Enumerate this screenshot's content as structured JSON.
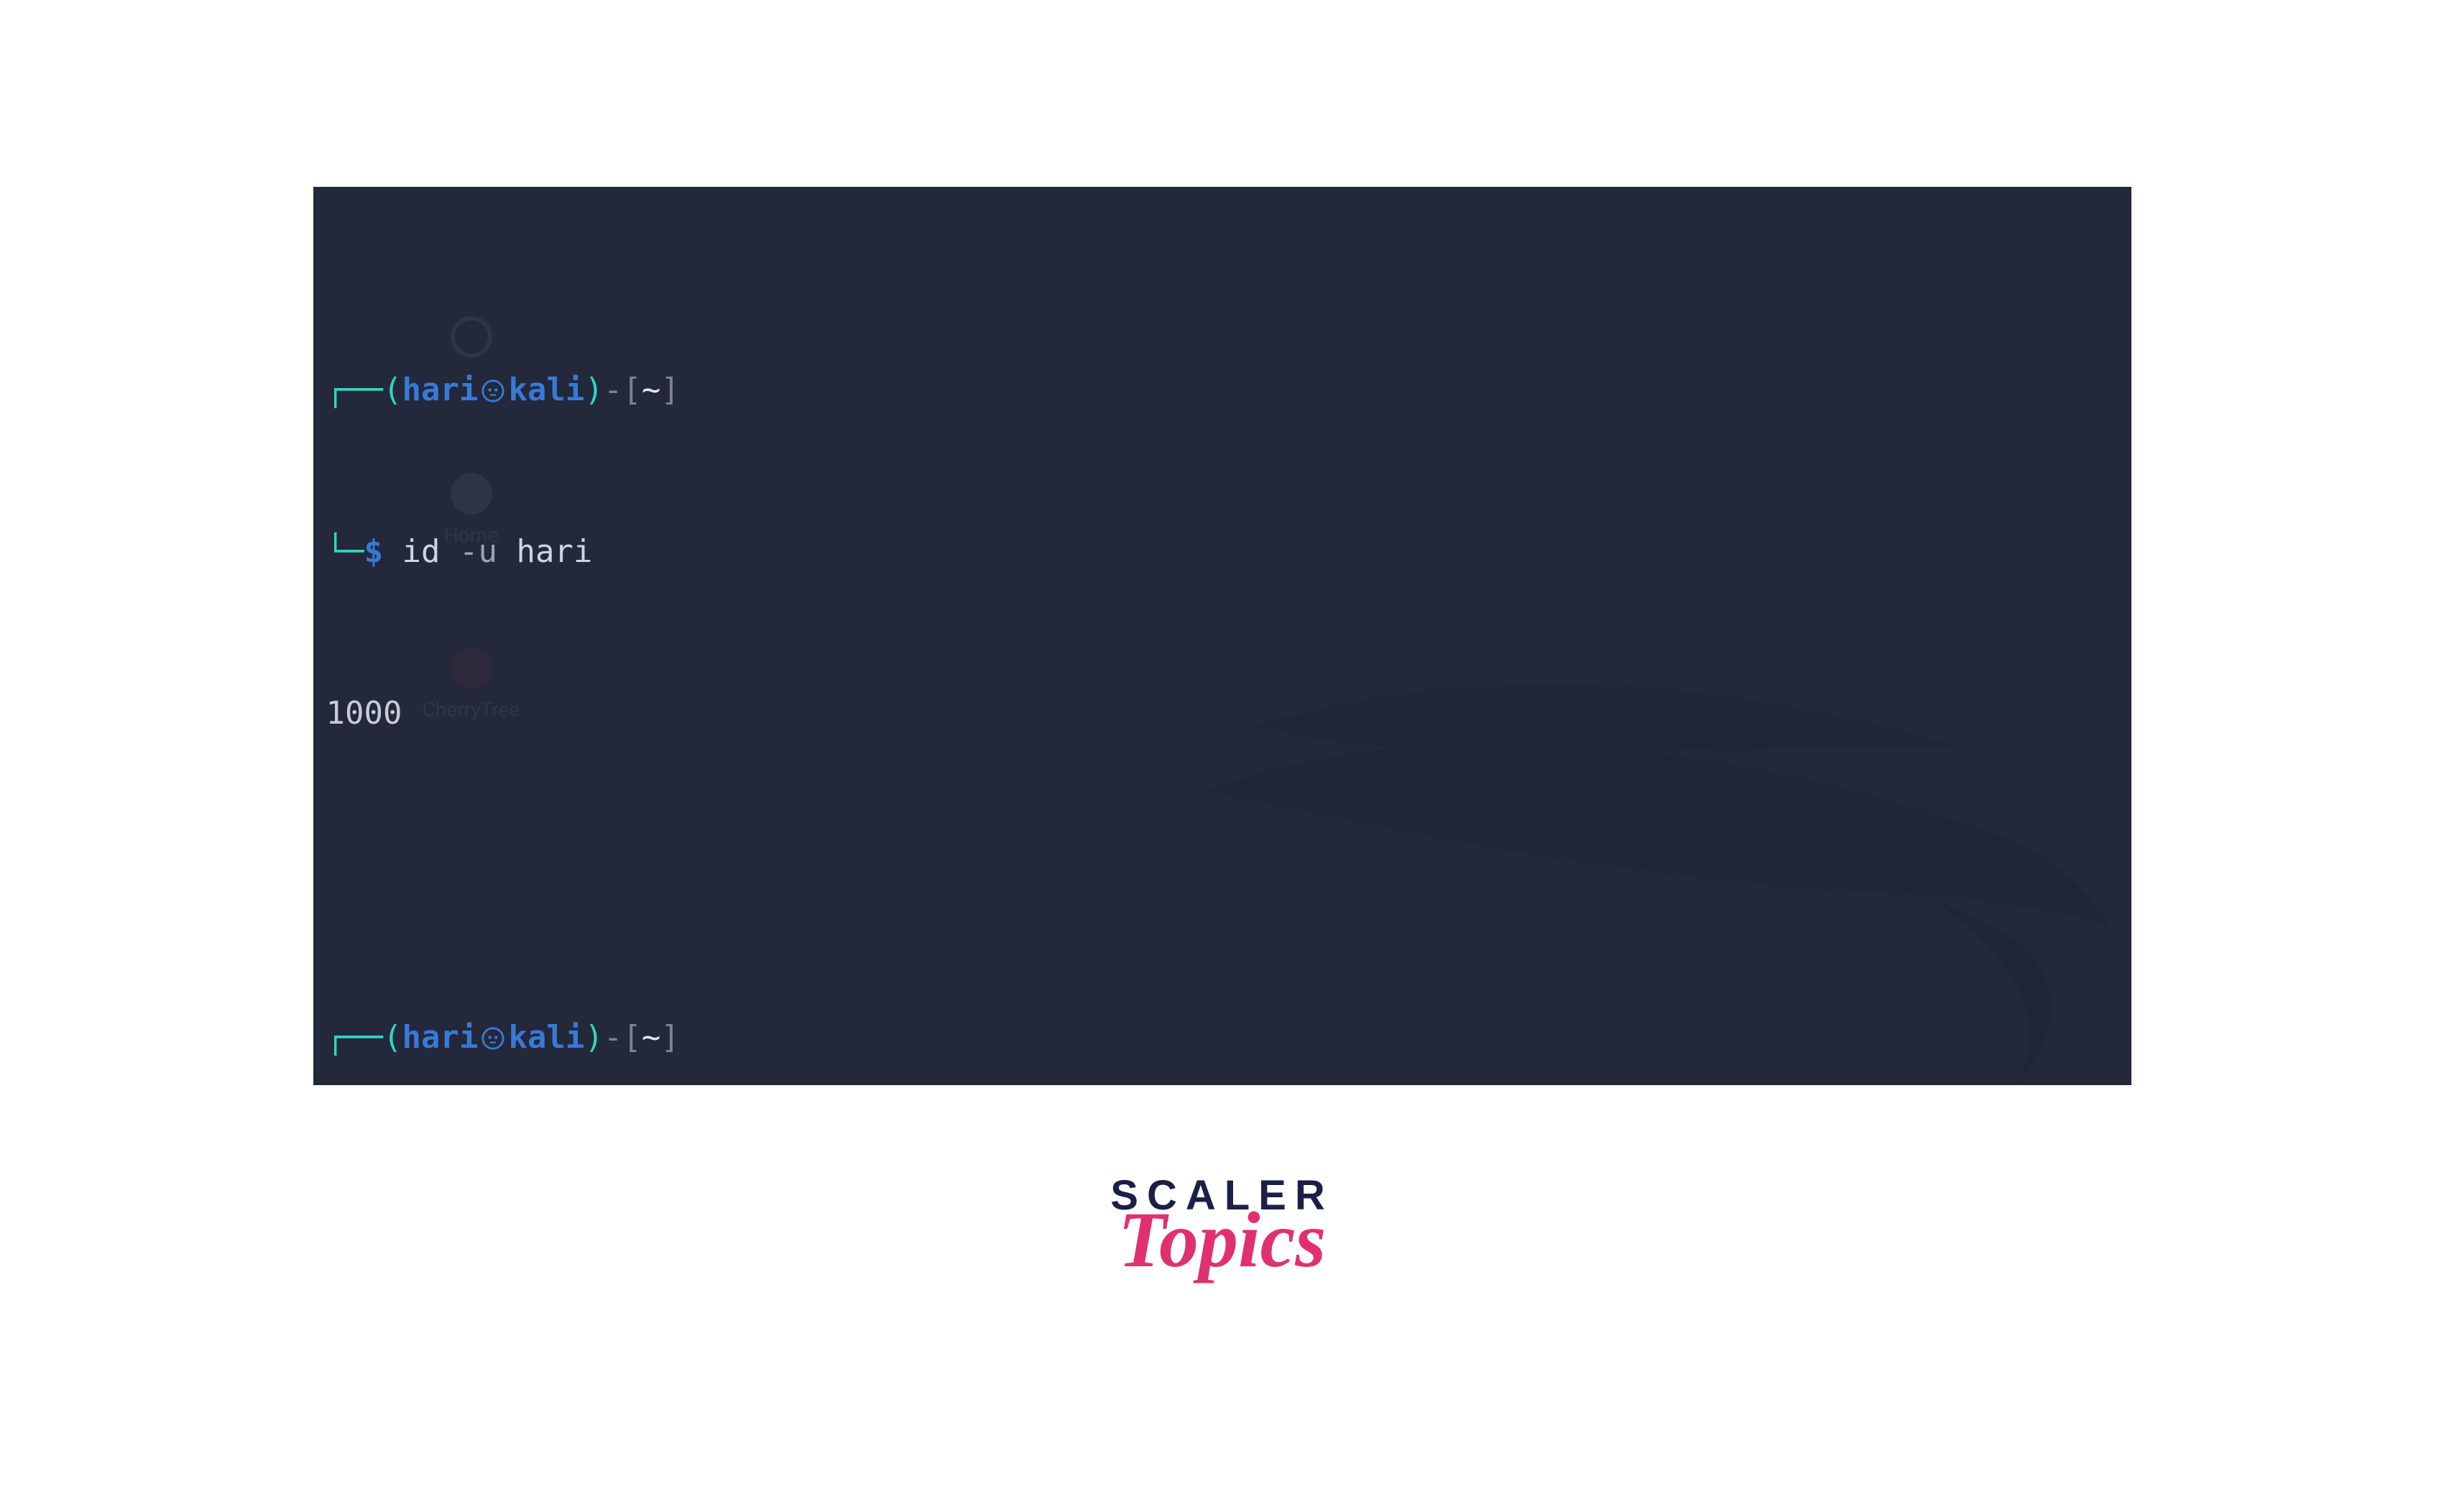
{
  "colors": {
    "bg": "#23283b",
    "teal": "#2fd7bf",
    "blue": "#377ad6",
    "grey": "#7b8196",
    "text": "#e4e6ef",
    "pink": "#e0316e",
    "navy": "#1a2046"
  },
  "prompt": {
    "corner_top": "┌──",
    "corner_bot": "└─",
    "paren_open": "(",
    "paren_close": ")",
    "user": "hari",
    "host": "kali",
    "sep_open": "-[",
    "cwd": "~",
    "sep_close": "]",
    "symbol": "$"
  },
  "session": {
    "command": "id",
    "flag": "-u",
    "arg": "hari",
    "output": "1000"
  },
  "desktop": {
    "icon1_label": "Home",
    "icon2_label": "CherryTree"
  },
  "logo": {
    "line1": "SCALER",
    "line2": "Topics"
  },
  "icons": {
    "skull": "skull-icon",
    "dragon": "kali-dragon-icon",
    "home": "home-icon",
    "cherry": "cherrytree-icon",
    "ring": "system-ring-icon"
  }
}
